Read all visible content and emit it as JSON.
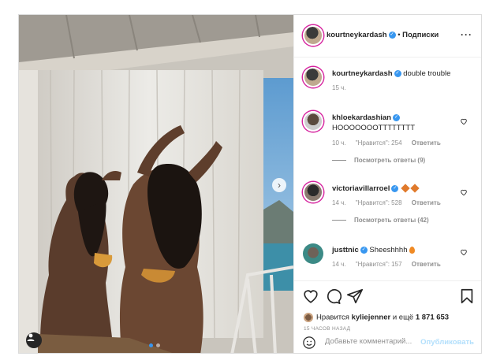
{
  "post": {
    "author": "kourtneykardash",
    "follow_label": "Подписки",
    "separator": "•",
    "more_label": "···",
    "caption_author": "kourtneykardash",
    "caption_text": "double trouble",
    "caption_time": "15 ч."
  },
  "comments": [
    {
      "author": "khloekardashian",
      "text": "HOOOOOOOTTTTTTTT",
      "time": "10 ч.",
      "likes": "\"Нравится\": 254",
      "reply": "Ответить",
      "view_replies": "Посмотреть ответы (9)"
    },
    {
      "author": "victoriavillarroel",
      "text": "",
      "time": "14 ч.",
      "likes": "\"Нравится\": 528",
      "reply": "Ответить",
      "view_replies": "Посмотреть ответы (42)"
    },
    {
      "author": "justtnic",
      "text": "Sheeshhhh",
      "time": "14 ч.",
      "likes": "\"Нравится\": 157",
      "reply": "Ответить"
    }
  ],
  "likes_line": {
    "prefix": "Нравится",
    "user": "kyliejenner",
    "connector": "и ещё",
    "count": "1 871 653"
  },
  "timestamp": "15 ЧАСОВ НАЗАД",
  "comment_box": {
    "placeholder": "Добавьте комментарий...",
    "publish": "Опубликовать"
  },
  "colors": {
    "accent": "#3897f0",
    "publish_disabled": "#b2dffc",
    "story_ring": "#d6249f",
    "emoji_orange": "#e07a2c"
  },
  "icons": [
    "heart-icon",
    "comment-icon",
    "share-icon",
    "bookmark-icon",
    "smile-icon",
    "user-tag-icon",
    "chevron-right-icon",
    "more-icon",
    "verified-icon"
  ],
  "carousel": {
    "current": 1,
    "total": 2
  }
}
